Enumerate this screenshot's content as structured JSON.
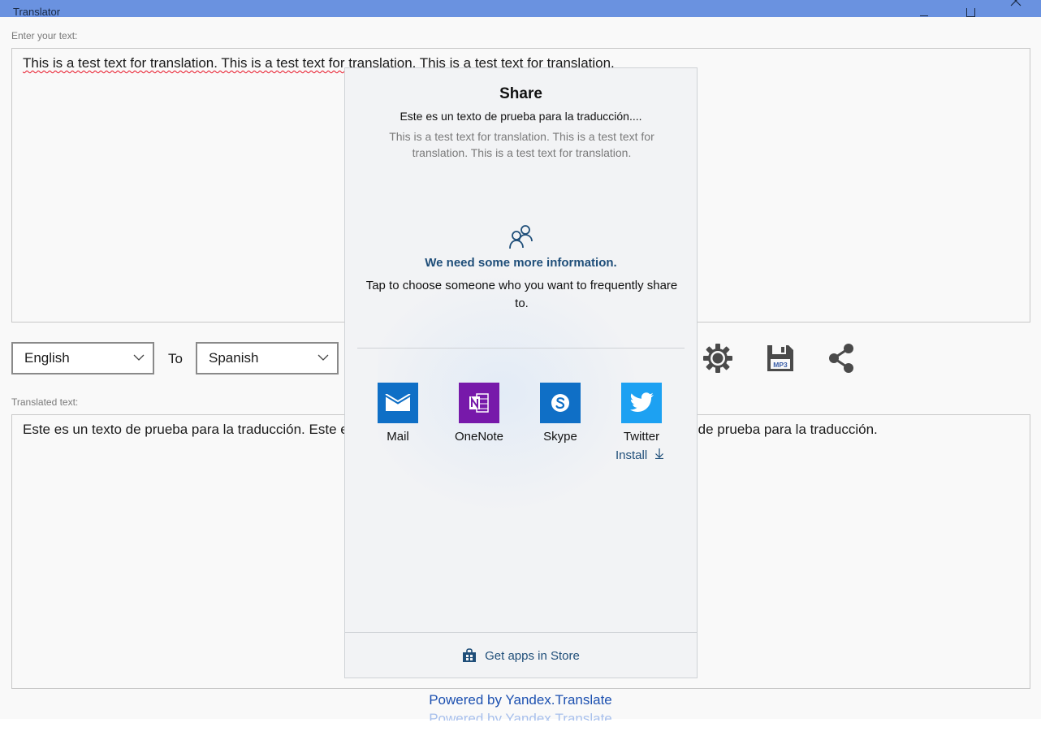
{
  "window": {
    "title": "Translator"
  },
  "input": {
    "label": "Enter your text:",
    "value": "This is a test text for translation. This is a test text for translation. This is a test text for translation."
  },
  "languages": {
    "from": "English",
    "to_label": "To",
    "to": "Spanish"
  },
  "toolbar": {
    "icons": [
      "gear-icon",
      "save-mp3-icon",
      "share-icon"
    ]
  },
  "output": {
    "label": "Translated text:",
    "value": "Este es un texto de prueba para la traducción. Este es un texto de prueba para la traducción. Este es un texto de prueba para la traducción."
  },
  "powered_by": "Powered by Yandex.Translate",
  "share": {
    "title": "Share",
    "translated_preview": "Este es un texto de prueba para la traducción....",
    "original_preview": "This is a test text for translation. This is a test text for translation. This is a test text for translation.",
    "info_heading": "We need some more information.",
    "info_text": "Tap to choose someone who you want to frequently share to.",
    "apps": [
      {
        "name": "Mail",
        "icon": "mail-icon",
        "color": "#0f6fc6"
      },
      {
        "name": "OneNote",
        "icon": "onenote-icon",
        "color": "#7719aa"
      },
      {
        "name": "Skype",
        "icon": "skype-icon",
        "color": "#0f6fc6"
      },
      {
        "name": "Twitter",
        "icon": "twitter-icon",
        "color": "#1da1f2"
      }
    ],
    "install_label": "Install",
    "store_label": "Get apps in Store"
  }
}
